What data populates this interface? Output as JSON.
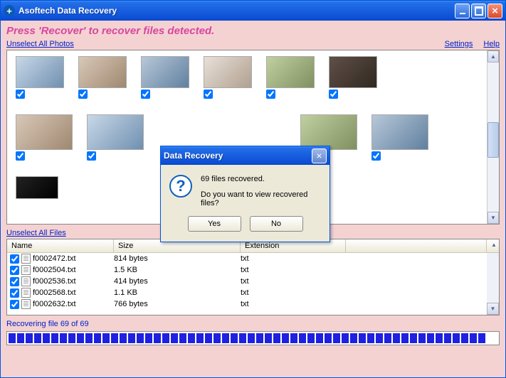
{
  "window": {
    "title": "Asoftech Data Recovery"
  },
  "instruction": "Press 'Recover' to recover files detected.",
  "links": {
    "unselect_photos": "Unselect All Photos",
    "unselect_files": "Unselect All Files",
    "settings": "Settings",
    "help": "Help"
  },
  "files": {
    "headers": {
      "name": "Name",
      "size": "Size",
      "ext": "Extension"
    },
    "rows": [
      {
        "name": "f0002472.txt",
        "size": "814 bytes",
        "ext": "txt"
      },
      {
        "name": "f0002504.txt",
        "size": "1.5 KB",
        "ext": "txt"
      },
      {
        "name": "f0002536.txt",
        "size": "414 bytes",
        "ext": "txt"
      },
      {
        "name": "f0002568.txt",
        "size": "1.1 KB",
        "ext": "txt"
      },
      {
        "name": "f0002632.txt",
        "size": "766 bytes",
        "ext": "txt"
      }
    ]
  },
  "status": "Recovering file 69 of 69",
  "dialog": {
    "title": "Data Recovery",
    "line1": "69 files recovered.",
    "line2": "Do you want to view recovered files?",
    "yes": "Yes",
    "no": "No"
  }
}
